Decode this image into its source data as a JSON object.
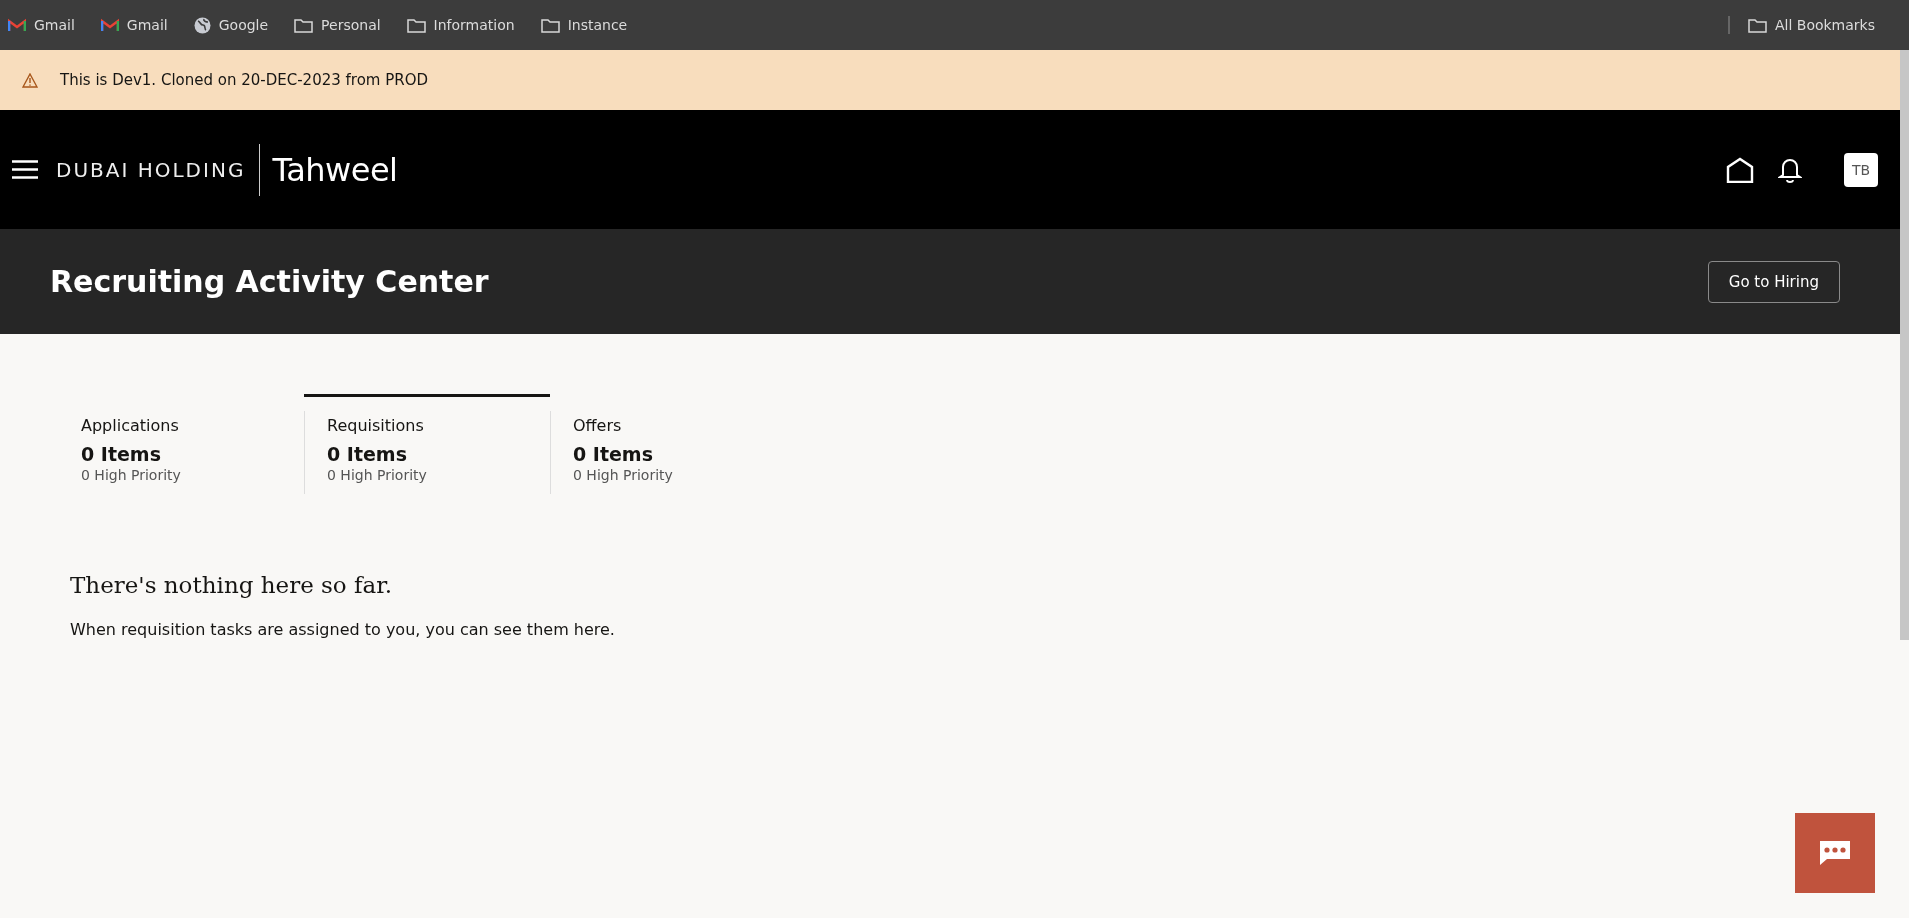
{
  "bookmarks_bar": {
    "items": [
      {
        "kind": "gmail",
        "label": "Gmail"
      },
      {
        "kind": "gmail",
        "label": "Gmail"
      },
      {
        "kind": "globe",
        "label": "Google"
      },
      {
        "kind": "folder",
        "label": "Personal"
      },
      {
        "kind": "folder",
        "label": "Information"
      },
      {
        "kind": "folder",
        "label": "Instance"
      }
    ],
    "all_bookmarks": "All Bookmarks"
  },
  "banner": {
    "text": "This is Dev1. Cloned on 20-DEC-2023 from PROD"
  },
  "header": {
    "logo_left": "DUBAI HOLDING",
    "logo_right": "Tahweel",
    "avatar": "TB"
  },
  "page_title": "Recruiting Activity Center",
  "go_button": "Go to Hiring",
  "tabs": [
    {
      "label": "Applications",
      "count": "0 Items",
      "priority": "0 High Priority",
      "selected": false
    },
    {
      "label": "Requisitions",
      "count": "0 Items",
      "priority": "0 High Priority",
      "selected": true
    },
    {
      "label": "Offers",
      "count": "0 Items",
      "priority": "0 High Priority",
      "selected": false
    }
  ],
  "empty_state": {
    "heading": "There's nothing here so far.",
    "message": "When requisition tasks are assigned to you, you can see them here."
  }
}
